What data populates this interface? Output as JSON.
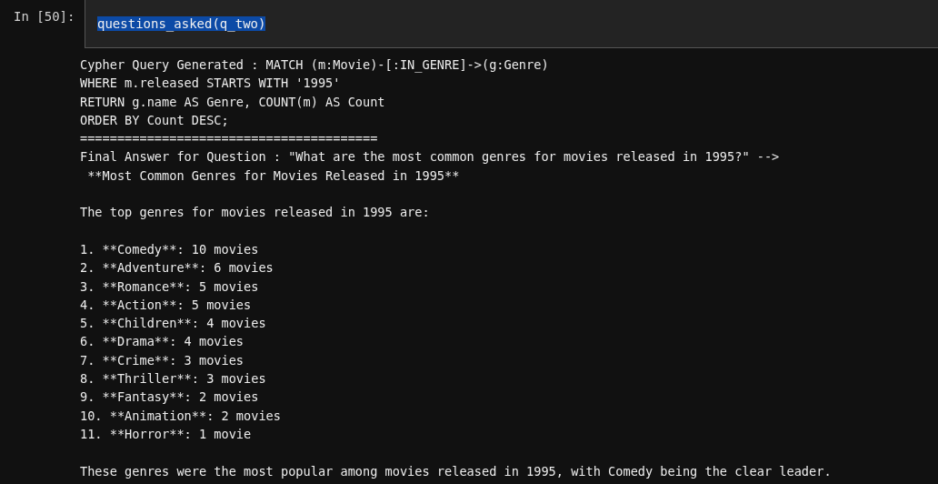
{
  "cell": {
    "prompt": "In [50]:",
    "code": {
      "text": "questions_asked(q_two)",
      "selected": true
    }
  },
  "output": {
    "paragraphs": [
      [
        "Cypher Query Generated : MATCH (m:Movie)-[:IN_GENRE]->(g:Genre)",
        "WHERE m.released STARTS WITH '1995'",
        "RETURN g.name AS Genre, COUNT(m) AS Count",
        "ORDER BY Count DESC;",
        "========================================",
        "Final Answer for Question : \"What are the most common genres for movies released in 1995?\" -->",
        " **Most Common Genres for Movies Released in 1995**"
      ],
      [
        "The top genres for movies released in 1995 are:"
      ],
      [
        "1. **Comedy**: 10 movies",
        "2. **Adventure**: 6 movies",
        "3. **Romance**: 5 movies",
        "4. **Action**: 5 movies",
        "5. **Children**: 4 movies",
        "6. **Drama**: 4 movies",
        "7. **Crime**: 3 movies",
        "8. **Thriller**: 3 movies",
        "9. **Fantasy**: 2 movies",
        "10. **Animation**: 2 movies",
        "11. **Horror**: 1 movie"
      ],
      [
        "These genres were the most popular among movies released in 1995, with Comedy being the clear leader."
      ]
    ]
  }
}
